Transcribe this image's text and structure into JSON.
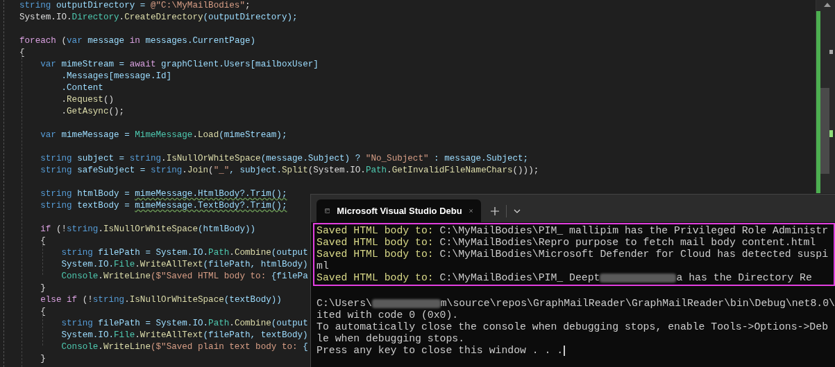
{
  "editor": {
    "lines": [
      {
        "kind": "code",
        "tokens": [
          {
            "t": "string",
            "kind": "keyword"
          },
          {
            "t": " outputDirectory = ",
            "kind": "identifier"
          },
          {
            "t": "@\"C:\\MyMailBodies\"",
            "kind": "literal"
          },
          {
            "t": ";",
            "kind": "punctuation"
          }
        ]
      },
      {
        "kind": "code",
        "tokens": [
          {
            "t": "System.IO.",
            "kind": "punctuation"
          },
          {
            "t": "Directory",
            "kind": "type"
          },
          {
            "t": ".",
            "kind": "punctuation"
          },
          {
            "t": "CreateDirectory",
            "kind": "method"
          },
          {
            "t": "(outputDirectory);",
            "kind": "identifier"
          }
        ]
      },
      {
        "kind": "blank"
      },
      {
        "kind": "code",
        "tokens": [
          {
            "t": "foreach",
            "kind": "control"
          },
          {
            "t": " (",
            "kind": "punctuation"
          },
          {
            "t": "var",
            "kind": "keyword"
          },
          {
            "t": " message ",
            "kind": "identifier"
          },
          {
            "t": "in",
            "kind": "control"
          },
          {
            "t": " messages.CurrentPage)",
            "kind": "identifier"
          }
        ]
      },
      {
        "kind": "code",
        "tokens": [
          {
            "t": "{",
            "kind": "punctuation"
          }
        ]
      },
      {
        "kind": "code",
        "tokens": [
          {
            "t": "    var",
            "kind": "keyword"
          },
          {
            "t": " mimeStream = ",
            "kind": "identifier"
          },
          {
            "t": "await",
            "kind": "control"
          },
          {
            "t": " graphClient.Users[mailboxUser]",
            "kind": "identifier"
          }
        ]
      },
      {
        "kind": "code",
        "tokens": [
          {
            "t": "        .Messages[message.Id]",
            "kind": "identifier"
          }
        ]
      },
      {
        "kind": "code",
        "tokens": [
          {
            "t": "        .Content",
            "kind": "identifier"
          }
        ]
      },
      {
        "kind": "code",
        "tokens": [
          {
            "t": "        .",
            "kind": "punctuation"
          },
          {
            "t": "Request",
            "kind": "method"
          },
          {
            "t": "()",
            "kind": "punctuation"
          }
        ]
      },
      {
        "kind": "code",
        "tokens": [
          {
            "t": "        .",
            "kind": "punctuation"
          },
          {
            "t": "GetAsync",
            "kind": "method"
          },
          {
            "t": "();",
            "kind": "punctuation"
          }
        ]
      },
      {
        "kind": "blank"
      },
      {
        "kind": "code",
        "tokens": [
          {
            "t": "    var",
            "kind": "keyword"
          },
          {
            "t": " mimeMessage = ",
            "kind": "identifier"
          },
          {
            "t": "MimeMessage",
            "kind": "type"
          },
          {
            "t": ".",
            "kind": "punctuation"
          },
          {
            "t": "Load",
            "kind": "method"
          },
          {
            "t": "(mimeStream);",
            "kind": "identifier"
          }
        ]
      },
      {
        "kind": "blank"
      },
      {
        "kind": "code",
        "tokens": [
          {
            "t": "    string",
            "kind": "keyword"
          },
          {
            "t": " subject = ",
            "kind": "identifier"
          },
          {
            "t": "string",
            "kind": "keyword"
          },
          {
            "t": ".",
            "kind": "punctuation"
          },
          {
            "t": "IsNullOrWhiteSpace",
            "kind": "method"
          },
          {
            "t": "(message.Subject) ? ",
            "kind": "identifier"
          },
          {
            "t": "\"No_Subject\"",
            "kind": "literal"
          },
          {
            "t": " : message.Subject;",
            "kind": "identifier"
          }
        ]
      },
      {
        "kind": "code",
        "tokens": [
          {
            "t": "    string",
            "kind": "keyword"
          },
          {
            "t": " safeSubject = ",
            "kind": "identifier"
          },
          {
            "t": "string",
            "kind": "keyword"
          },
          {
            "t": ".",
            "kind": "punctuation"
          },
          {
            "t": "Join",
            "kind": "method"
          },
          {
            "t": "(",
            "kind": "punctuation"
          },
          {
            "t": "\"_\"",
            "kind": "literal"
          },
          {
            "t": ", subject.",
            "kind": "identifier"
          },
          {
            "t": "Split",
            "kind": "method"
          },
          {
            "t": "(System.IO.",
            "kind": "punctuation"
          },
          {
            "t": "Path",
            "kind": "type"
          },
          {
            "t": ".",
            "kind": "punctuation"
          },
          {
            "t": "GetInvalidFileNameChars",
            "kind": "method"
          },
          {
            "t": "()));",
            "kind": "punctuation"
          }
        ]
      },
      {
        "kind": "blank"
      },
      {
        "kind": "code",
        "tokens": [
          {
            "t": "    string",
            "kind": "keyword"
          },
          {
            "t": " htmlBody = ",
            "kind": "identifier"
          },
          {
            "t": "mimeMessage.HtmlBody?.Trim();",
            "kind": "identifier",
            "squiggle": true
          }
        ]
      },
      {
        "kind": "code",
        "tokens": [
          {
            "t": "    string",
            "kind": "keyword"
          },
          {
            "t": " textBody = ",
            "kind": "identifier"
          },
          {
            "t": "mimeMessage.TextBody?.Trim();",
            "kind": "identifier",
            "squiggle": true
          }
        ]
      },
      {
        "kind": "blank"
      },
      {
        "kind": "code",
        "tokens": [
          {
            "t": "    if",
            "kind": "control"
          },
          {
            "t": " (!",
            "kind": "punctuation"
          },
          {
            "t": "string",
            "kind": "keyword"
          },
          {
            "t": ".",
            "kind": "punctuation"
          },
          {
            "t": "IsNullOrWhiteSpace",
            "kind": "method"
          },
          {
            "t": "(htmlBody))",
            "kind": "identifier"
          }
        ]
      },
      {
        "kind": "code",
        "tokens": [
          {
            "t": "    {",
            "kind": "punctuation"
          }
        ]
      },
      {
        "kind": "code",
        "tokens": [
          {
            "t": "        string",
            "kind": "keyword"
          },
          {
            "t": " filePath = System.IO.",
            "kind": "identifier"
          },
          {
            "t": "Path",
            "kind": "type"
          },
          {
            "t": ".",
            "kind": "punctuation"
          },
          {
            "t": "Combine",
            "kind": "method"
          },
          {
            "t": "(output",
            "kind": "identifier"
          }
        ]
      },
      {
        "kind": "code",
        "tokens": [
          {
            "t": "        System.IO.",
            "kind": "identifier"
          },
          {
            "t": "File",
            "kind": "type"
          },
          {
            "t": ".",
            "kind": "punctuation"
          },
          {
            "t": "WriteAllText",
            "kind": "method"
          },
          {
            "t": "(filePath, htmlBody)",
            "kind": "identifier"
          }
        ]
      },
      {
        "kind": "code",
        "tokens": [
          {
            "t": "        Console",
            "kind": "type"
          },
          {
            "t": ".",
            "kind": "punctuation"
          },
          {
            "t": "WriteLine",
            "kind": "method"
          },
          {
            "t": "($\"Saved HTML body to: ",
            "kind": "literal"
          },
          {
            "t": "{filePa",
            "kind": "identifier"
          }
        ]
      },
      {
        "kind": "code",
        "tokens": [
          {
            "t": "    }",
            "kind": "punctuation"
          }
        ]
      },
      {
        "kind": "code",
        "tokens": [
          {
            "t": "    else if",
            "kind": "control"
          },
          {
            "t": " (!",
            "kind": "punctuation"
          },
          {
            "t": "string",
            "kind": "keyword"
          },
          {
            "t": ".",
            "kind": "punctuation"
          },
          {
            "t": "IsNullOrWhiteSpace",
            "kind": "method"
          },
          {
            "t": "(textBody))",
            "kind": "identifier"
          }
        ]
      },
      {
        "kind": "code",
        "tokens": [
          {
            "t": "    {",
            "kind": "punctuation"
          }
        ]
      },
      {
        "kind": "code",
        "tokens": [
          {
            "t": "        string",
            "kind": "keyword"
          },
          {
            "t": " filePath = System.IO.",
            "kind": "identifier"
          },
          {
            "t": "Path",
            "kind": "type"
          },
          {
            "t": ".",
            "kind": "punctuation"
          },
          {
            "t": "Combine",
            "kind": "method"
          },
          {
            "t": "(output",
            "kind": "identifier"
          }
        ]
      },
      {
        "kind": "code",
        "tokens": [
          {
            "t": "        System.IO.",
            "kind": "identifier"
          },
          {
            "t": "File",
            "kind": "type"
          },
          {
            "t": ".",
            "kind": "punctuation"
          },
          {
            "t": "WriteAllText",
            "kind": "method"
          },
          {
            "t": "(filePath, textBody)",
            "kind": "identifier"
          }
        ]
      },
      {
        "kind": "code",
        "tokens": [
          {
            "t": "        Console",
            "kind": "type"
          },
          {
            "t": ".",
            "kind": "punctuation"
          },
          {
            "t": "WriteLine",
            "kind": "method"
          },
          {
            "t": "($\"Saved plain text body to: ",
            "kind": "literal"
          },
          {
            "t": "{",
            "kind": "identifier"
          }
        ]
      },
      {
        "kind": "code",
        "tokens": [
          {
            "t": "    }",
            "kind": "punctuation"
          }
        ]
      }
    ]
  },
  "console": {
    "tab_title": "Microsoft Visual Studio Debu",
    "blocks": [
      {
        "highlighted": true,
        "lines": [
          [
            {
              "t": "Saved HTML body to: ",
              "kind": "label"
            },
            {
              "t": "C:\\MyMailBodies\\PIM_ mallipim has the Privileged Role Administr",
              "kind": "text"
            }
          ],
          [
            {
              "t": "Saved HTML body to: ",
              "kind": "label"
            },
            {
              "t": "C:\\MyMailBodies\\Repro purpose to fetch mail body content.html",
              "kind": "text"
            }
          ],
          [
            {
              "t": "Saved HTML body to: ",
              "kind": "label"
            },
            {
              "t": "C:\\MyMailBodies\\Microsoft Defender for Cloud has detected suspi",
              "kind": "text"
            }
          ],
          [
            {
              "t": "ml",
              "kind": "text"
            }
          ],
          [
            {
              "t": "Saved HTML body to: ",
              "kind": "label"
            },
            {
              "t": "C:\\MyMailBodies\\PIM_ Deept",
              "kind": "text"
            },
            {
              "kind": "redacted"
            },
            {
              "t": "a has the Directory Re",
              "kind": "text"
            }
          ]
        ]
      },
      {
        "highlighted": false,
        "lines": [
          [
            {
              "t": "C:\\Users\\",
              "kind": "text"
            },
            {
              "kind": "redacted"
            },
            {
              "t": "m\\source\\repos\\GraphMailReader\\GraphMailReader\\bin\\Debug\\net8.0\\",
              "kind": "text"
            }
          ],
          [
            {
              "t": "ited with code 0 (0x0).",
              "kind": "text"
            }
          ],
          [
            {
              "t": "To automatically close the console when debugging stops, enable Tools->Options->Deb",
              "kind": "text"
            }
          ],
          [
            {
              "t": "le when debugging stops.",
              "kind": "text"
            }
          ],
          [
            {
              "t": "Press any key to close this window . . .",
              "kind": "text"
            },
            {
              "kind": "cursor"
            }
          ]
        ]
      }
    ]
  }
}
